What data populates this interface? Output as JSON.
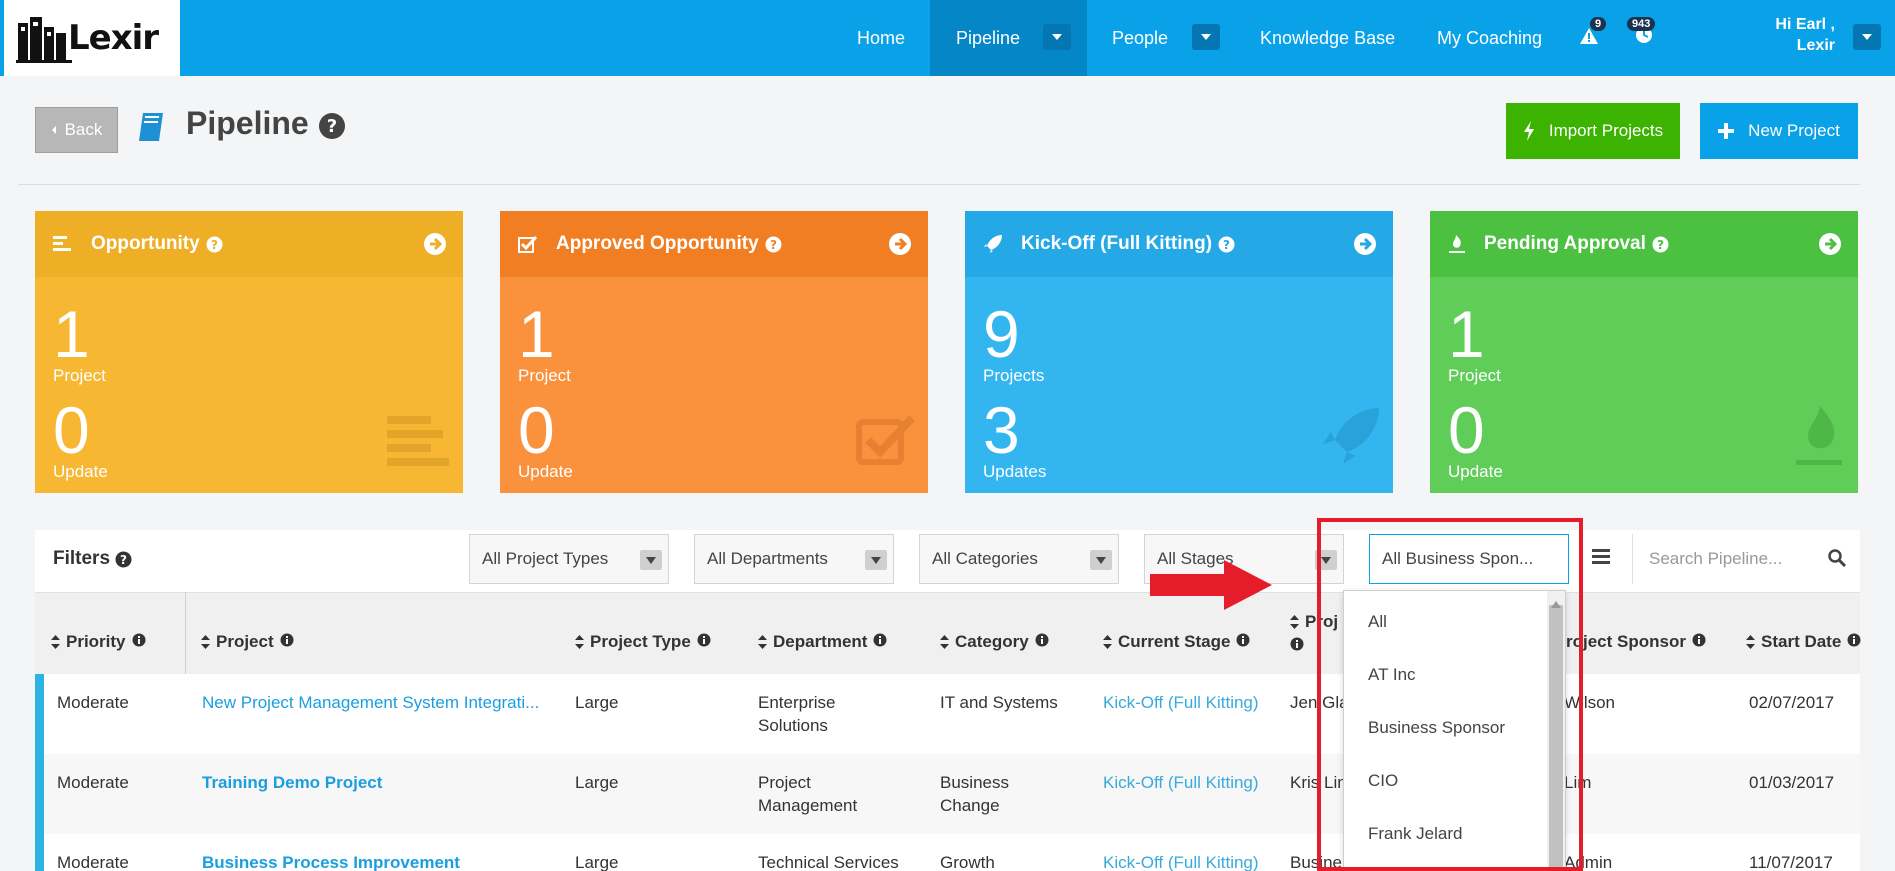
{
  "nav": {
    "logo_text": "Lexir",
    "items": [
      {
        "label": "Home"
      },
      {
        "label": "Pipeline"
      },
      {
        "label": "People"
      },
      {
        "label": "Knowledge Base"
      },
      {
        "label": "My Coaching"
      }
    ],
    "alerts_count": "9",
    "notifications_count": "943",
    "user_greeting": "Hi Earl ,",
    "user_org": "Lexir"
  },
  "header": {
    "back_label": "Back",
    "title": "Pipeline",
    "import_label": "Import Projects",
    "new_label": "New Project"
  },
  "cards": [
    {
      "title": "Opportunity",
      "count1": "1",
      "label1": "Project",
      "count2": "0",
      "label2": "Update",
      "color": "#f7b733",
      "head_color": "#eeae26"
    },
    {
      "title": "Approved Opportunity",
      "count1": "1",
      "label1": "Project",
      "count2": "0",
      "label2": "Update",
      "color": "#fa913d",
      "head_color": "#f17e22"
    },
    {
      "title": "Kick-Off (Full Kitting)",
      "count1": "9",
      "label1": "Projects",
      "count2": "3",
      "label2": "Updates",
      "color": "#33b5f0",
      "head_color": "#25a8e6"
    },
    {
      "title": "Pending Approval",
      "count1": "1",
      "label1": "Project",
      "count2": "0",
      "label2": "Update",
      "color": "#5fcd57",
      "head_color": "#4cc141"
    }
  ],
  "filters": {
    "label": "Filters",
    "project_types": "All Project Types",
    "departments": "All Departments",
    "categories": "All Categories",
    "stages": "All Stages",
    "business_sponsor": "All Business Spon...",
    "search_placeholder": "Search Pipeline..."
  },
  "sponsor_options": [
    "All",
    "AT Inc",
    "Business Sponsor",
    "CIO",
    "Frank Jelard"
  ],
  "table": {
    "headers": {
      "priority": "Priority",
      "project": "Project",
      "project_type": "Project Type",
      "department": "Department",
      "category": "Category",
      "current_stage": "Current Stage",
      "project_manager": "Proj",
      "project_sponsor": "roject Sponsor",
      "start_date": "Start Date"
    },
    "rows": [
      {
        "priority": "Moderate",
        "project": "New Project Management System Integrati...",
        "type": "Large",
        "department_l1": "Enterprise",
        "department_l2": "Solutions",
        "category_l1": "IT and Systems",
        "category_l2": "",
        "stage": "Kick-Off (Full Kitting)",
        "manager": "Jen Gla",
        "sponsor": "Wilson",
        "start": "02/07/2017"
      },
      {
        "priority": "Moderate",
        "project": "Training Demo Project",
        "type": "Large",
        "department_l1": "Project",
        "department_l2": "Management",
        "category_l1": "Business",
        "category_l2": "Change",
        "stage": "Kick-Off (Full Kitting)",
        "manager": "Kris Lin",
        "sponsor": "Lim",
        "start": "01/03/2017"
      },
      {
        "priority": "Moderate",
        "project": "Business Process Improvement",
        "type": "Large",
        "department_l1": "Technical Services",
        "department_l2": "",
        "category_l1": "Growth",
        "category_l2": "",
        "stage": "Kick-Off (Full Kitting)",
        "manager": "Busine",
        "sponsor": "Admin",
        "start": "11/07/2017"
      }
    ]
  }
}
